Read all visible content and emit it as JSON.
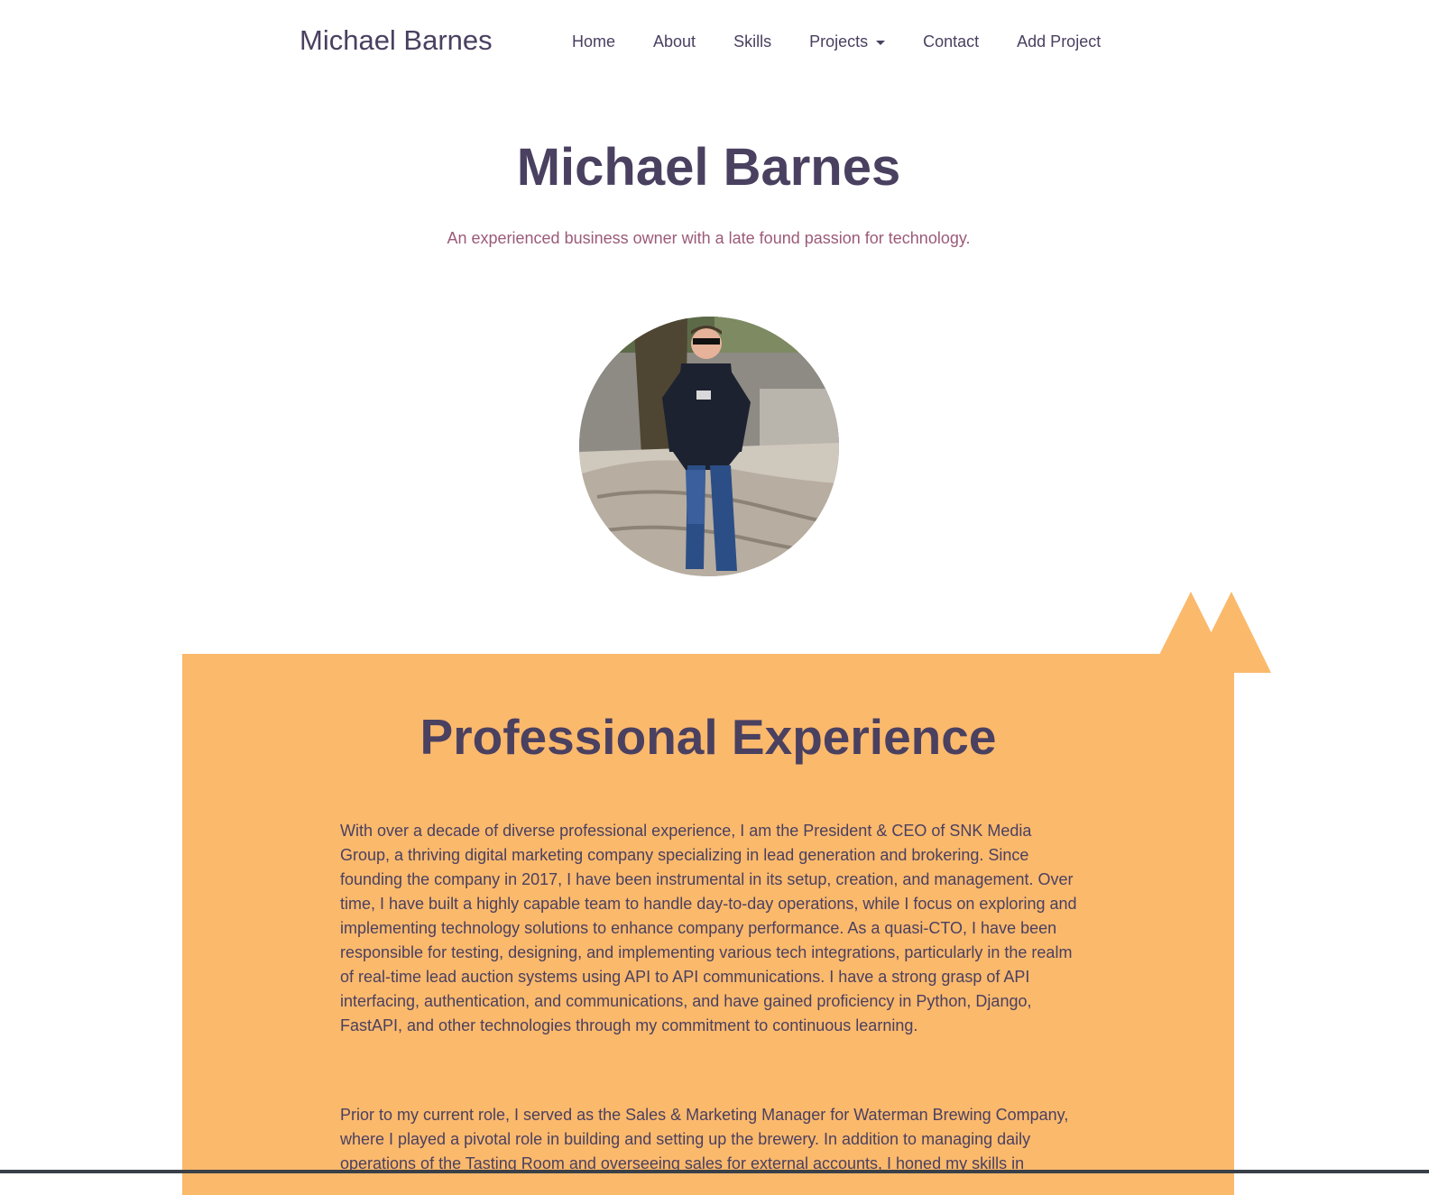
{
  "nav": {
    "brand": "Michael Barnes",
    "links": [
      "Home",
      "About",
      "Skills",
      "Projects",
      "Contact",
      "Add Project"
    ]
  },
  "hero": {
    "title": "Michael Barnes",
    "subtitle": "An experienced business owner with a late found passion for technology."
  },
  "experience": {
    "title": "Professional Experience",
    "paragraphs": [
      "With over a decade of diverse professional experience, I am the President & CEO of SNK Media Group, a thriving digital marketing company specializing in lead generation and brokering. Since founding the company in 2017, I have been instrumental in its setup, creation, and management. Over time, I have built a highly capable team to handle day-to-day operations, while I focus on exploring and implementing technology solutions to enhance company performance. As a quasi-CTO, I have been responsible for testing, designing, and implementing various tech integrations, particularly in the realm of real-time lead auction systems using API to API communications. I have a strong grasp of API interfacing, authentication, and communications, and have gained proficiency in Python, Django, FastAPI, and other technologies through my commitment to continuous learning.",
      "Prior to my current role, I served as the Sales & Marketing Manager for Waterman Brewing Company, where I played a pivotal role in building and setting up the brewery. In addition to managing daily operations of the Tasting Room and overseeing sales for external accounts, I honed my skills in"
    ]
  },
  "colors": {
    "text": "#4a4060",
    "subtitle": "#9b5a78",
    "section_bg": "#fbb96c"
  },
  "icons": {
    "dropdown": "caret-down-icon",
    "decoration": "mountain-icon"
  }
}
